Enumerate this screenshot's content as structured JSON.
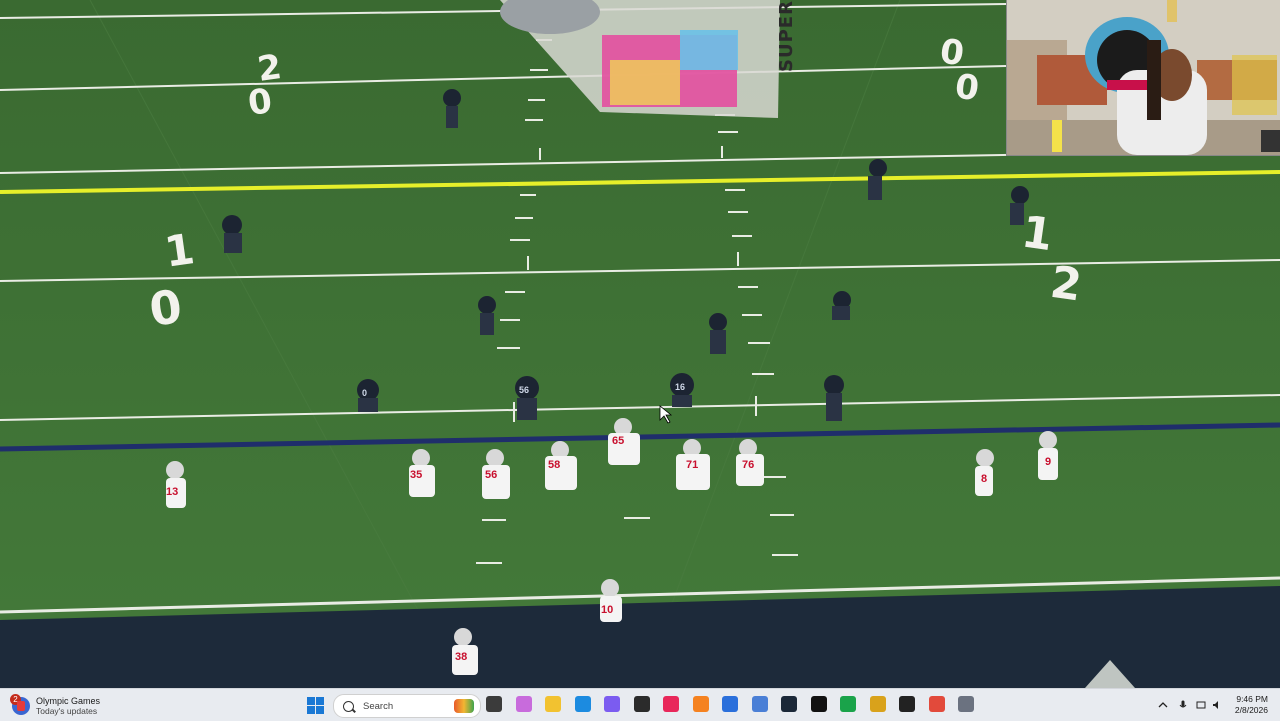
{
  "taskbar": {
    "widget": {
      "title": "Olympic Games",
      "subtitle": "Today's updates",
      "badge_count": "2"
    },
    "search": {
      "placeholder": "Search"
    },
    "clock": {
      "time": "9:46 PM",
      "date": "2/8/2026"
    },
    "pinned_apps": [
      {
        "name": "task-view",
        "color": "#3b3b3b"
      },
      {
        "name": "copilot",
        "color": "#c86bdc"
      },
      {
        "name": "file-explorer",
        "color": "#f2c230"
      },
      {
        "name": "edge",
        "color": "#1c8be0"
      },
      {
        "name": "messenger",
        "color": "#7b5cf0"
      },
      {
        "name": "obs",
        "color": "#2b2b2b"
      },
      {
        "name": "capcut",
        "color": "#e8275a"
      },
      {
        "name": "vlc",
        "color": "#f58220"
      },
      {
        "name": "store",
        "color": "#2a6fdb"
      },
      {
        "name": "app-blue",
        "color": "#4a7fd6"
      },
      {
        "name": "steam",
        "color": "#1b2838"
      },
      {
        "name": "tiktok",
        "color": "#111111"
      },
      {
        "name": "xbox",
        "color": "#1aa34a"
      },
      {
        "name": "app-gold",
        "color": "#d9a21b"
      },
      {
        "name": "app-film",
        "color": "#222222"
      },
      {
        "name": "chrome",
        "color": "#e24a3b"
      },
      {
        "name": "settings",
        "color": "#6b7280"
      }
    ]
  },
  "field": {
    "colors": {
      "turf": "#3e6e34",
      "first_down_line": "#e6ef2a",
      "scrimmage_line": "#1f2e6b",
      "end_zone": "#1d2a3a"
    },
    "yard_numbers": [
      "2",
      "0",
      "1",
      "0",
      "0",
      "1",
      "2",
      "0"
    ],
    "logo_text": "SUPER",
    "offense_numbers": [
      "13",
      "35",
      "56",
      "58",
      "65",
      "71",
      "76",
      "8",
      "9",
      "10",
      "38"
    ],
    "defense_numbers": [
      "0",
      "56",
      "16"
    ]
  }
}
